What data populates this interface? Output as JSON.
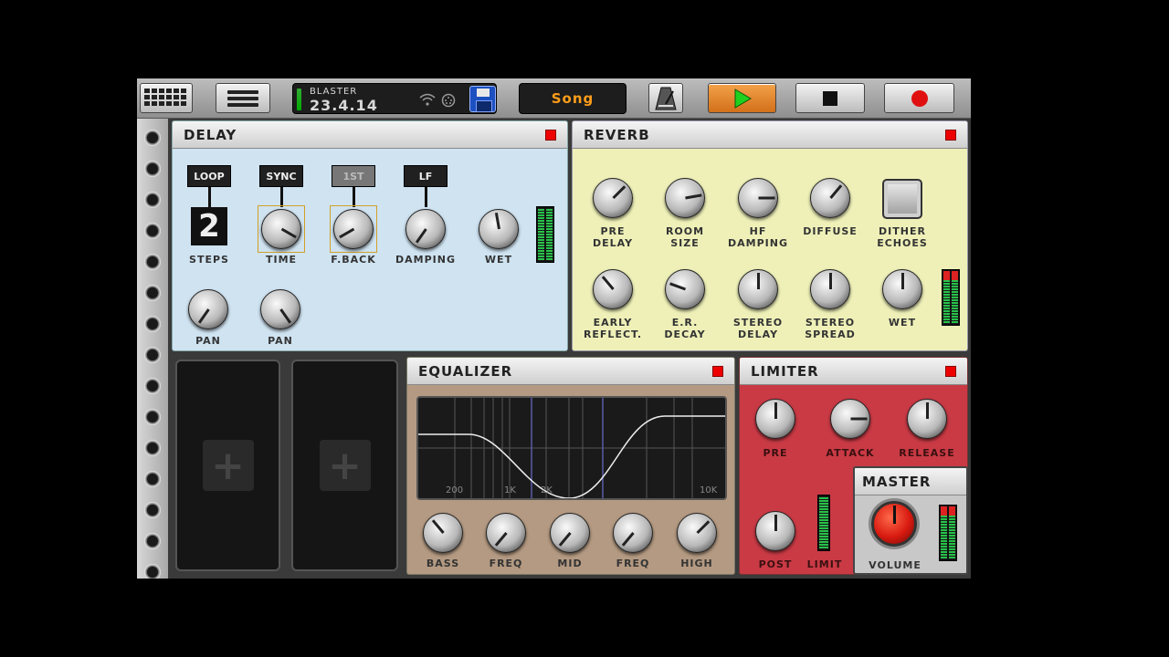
{
  "toolbar": {
    "grid_icon": "grid-icon",
    "menu_icon": "hamburger-menu-icon",
    "project_name": "BLASTER",
    "project_version": "23.4.14",
    "wifi_icon": "wifi-icon",
    "midi_icon": "midi-icon",
    "save_icon": "floppy-disk-icon",
    "mode_label": "Song",
    "metronome_icon": "metronome-icon",
    "play_icon": "play-icon",
    "stop_icon": "stop-icon",
    "record_icon": "record-icon"
  },
  "delay": {
    "title": "DELAY",
    "toggles": [
      "LOOP",
      "SYNC",
      "1ST",
      "LF"
    ],
    "steps_value": "2",
    "knobs_row1": [
      "STEPS",
      "TIME",
      "F.BACK",
      "DAMPING",
      "WET"
    ],
    "knobs_row2": [
      "PAN",
      "PAN"
    ]
  },
  "reverb": {
    "title": "REVERB",
    "row1": [
      "PRE\nDELAY",
      "ROOM\nSIZE",
      "HF\nDAMPING",
      "DIFFUSE",
      "DITHER\nECHOES"
    ],
    "row2": [
      "EARLY\nREFLECT.",
      "E.R.\nDECAY",
      "STEREO\nDELAY",
      "STEREO\nSPREAD",
      "WET"
    ]
  },
  "equalizer": {
    "title": "EQUALIZER",
    "freq_labels": [
      "200",
      "1K",
      "2K",
      "10K"
    ],
    "knobs": [
      "BASS",
      "FREQ",
      "MID",
      "FREQ",
      "HIGH"
    ]
  },
  "limiter": {
    "title": "LIMITER",
    "knobs": [
      "PRE",
      "ATTACK",
      "RELEASE",
      "POST"
    ],
    "limit_label": "LIMIT"
  },
  "master": {
    "title": "MASTER",
    "volume_label": "VOLUME"
  },
  "colors": {
    "delay_bg": "#cfe3f1",
    "reverb_bg": "#eef0b8",
    "eq_bg": "#b49a82",
    "limiter_bg": "#c93a45",
    "master_bg": "#c8c8c8",
    "play_bg": "#e98a2a",
    "record": "#e01010"
  }
}
